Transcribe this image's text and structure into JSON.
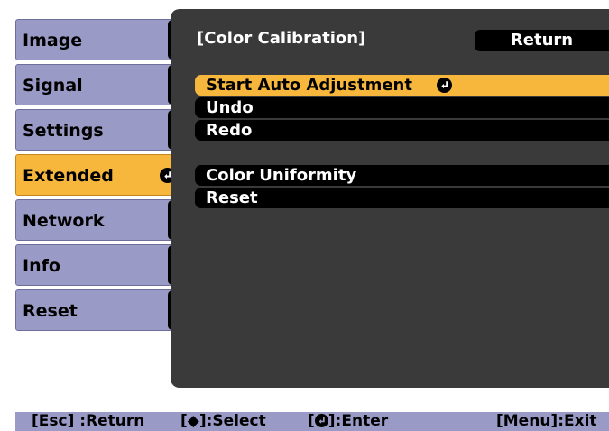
{
  "sidebar": {
    "items": [
      {
        "label": "Image"
      },
      {
        "label": "Signal"
      },
      {
        "label": "Settings"
      },
      {
        "label": "Extended"
      },
      {
        "label": "Network"
      },
      {
        "label": "Info"
      },
      {
        "label": "Reset"
      }
    ],
    "active_index": 3
  },
  "panel": {
    "title": "[Color Calibration]",
    "return_label": "Return",
    "items": [
      {
        "label": "Start Auto Adjustment"
      },
      {
        "label": "Undo"
      },
      {
        "label": "Redo"
      },
      {
        "label": "Color Uniformity"
      },
      {
        "label": "Reset"
      }
    ],
    "selected_index": 0
  },
  "status_bar": {
    "esc": "[Esc] :Return",
    "select": "[◆]:Select",
    "enter": "[",
    "enter_suffix": "]:Enter",
    "menu": "[Menu]:Exit"
  },
  "colors": {
    "highlight": "#f6b73c",
    "sidebar": "#9a9ac6",
    "panel": "#3a3a3a"
  }
}
